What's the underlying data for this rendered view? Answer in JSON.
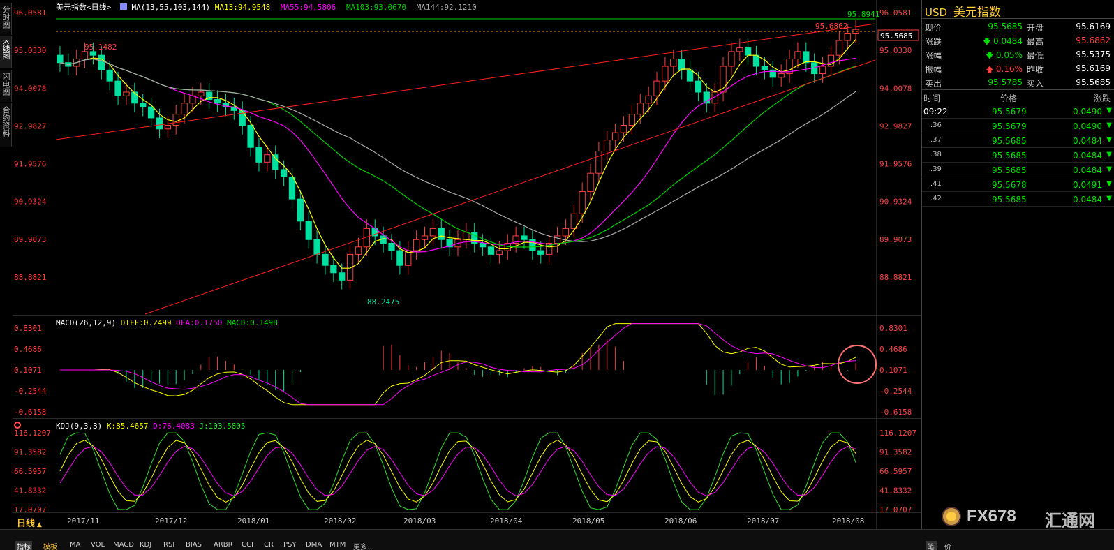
{
  "left_tabs": [
    {
      "label": "分时图"
    },
    {
      "label": "K线图"
    },
    {
      "label": "闪电图"
    },
    {
      "label": "合约资料"
    }
  ],
  "main_legend": {
    "name": "美元指数",
    "period": "<日线>",
    "ma_prefix": "MA(13,55,103,144)",
    "ma13": "MA13:94.9548",
    "ma55": "MA55:94.5806",
    "ma103": "MA103:93.0670",
    "ma144": "MA144:92.1210"
  },
  "price_axis": [
    "96.0581",
    "95.0330",
    "94.0078",
    "92.9827",
    "91.9576",
    "90.9324",
    "89.9073",
    "88.8821"
  ],
  "annotations": {
    "high_left": "95.1482",
    "low": "88.2475",
    "high_right": "95.6862",
    "top_line": "95.8941",
    "current_box": "95.5685"
  },
  "macd_legend": {
    "name": "MACD(26,12,9)",
    "diff": "DIFF:0.2499",
    "dea": "DEA:0.1750",
    "macd": "MACD:0.1498"
  },
  "macd_axis": [
    "0.8301",
    "0.4686",
    "0.1071",
    "-0.2544",
    "-0.6158"
  ],
  "kdj_legend": {
    "name": "KDJ(9,3,3)",
    "k": "K:85.4657",
    "d": "D:76.4083",
    "j": "J:103.5805"
  },
  "kdj_axis": [
    "116.1207",
    "91.3582",
    "66.5957",
    "41.8332",
    "17.0707"
  ],
  "x_axis": [
    "2017/11",
    "2017/12",
    "2018/01",
    "2018/02",
    "2018/03",
    "2018/04",
    "2018/05",
    "2018/06",
    "2018/07",
    "2018/08"
  ],
  "quote": {
    "code": "USD",
    "name": "美元指数",
    "rows": [
      {
        "l1": "现价",
        "v1": "95.5685",
        "l2": "开盘",
        "v2": "95.6169"
      },
      {
        "l1": "涨跌",
        "v1": "0.0484",
        "l2": "最高",
        "v2": "95.6862"
      },
      {
        "l1": "涨幅",
        "v1": "0.05%",
        "l2": "最低",
        "v2": "95.5375"
      },
      {
        "l1": "振幅",
        "v1": "0.16%",
        "l2": "昨收",
        "v2": "95.6169"
      },
      {
        "l1": "卖出",
        "v1": "95.5785",
        "l2": "买入",
        "v2": "95.5685"
      }
    ],
    "tick_header": {
      "time": "时间",
      "price": "价格",
      "change": "涨跌"
    },
    "ticks": [
      {
        "time": "09:22",
        "price": "95.5679",
        "change": "0.0490"
      },
      {
        "time": ".36",
        "price": "95.5679",
        "change": "0.0490"
      },
      {
        "time": ".37",
        "price": "95.5685",
        "change": "0.0484"
      },
      {
        "time": ".38",
        "price": "95.5685",
        "change": "0.0484"
      },
      {
        "time": ".39",
        "price": "95.5685",
        "change": "0.0484"
      },
      {
        "time": ".41",
        "price": "95.5678",
        "change": "0.0491"
      },
      {
        "time": ".42",
        "price": "95.5685",
        "change": "0.0484"
      }
    ]
  },
  "bottom": {
    "period_label": "日线",
    "tabs": [
      "指标",
      "模板",
      "MA",
      "VOL",
      "MACD",
      "KDJ",
      "RSI",
      "BIAS",
      "ARBR",
      "CCI",
      "CR",
      "PSY",
      "DMA",
      "MTM",
      "更多..."
    ],
    "right_tabs": [
      "笔",
      "价"
    ]
  },
  "logo": {
    "text": "FX678",
    "cn": "汇通网"
  },
  "colors": {
    "up": "#ff4040",
    "down": "#00e0a0",
    "ma13": "#ffff00",
    "ma55": "#ff00ff",
    "ma103": "#00d000",
    "ma144": "#aaaaaa",
    "trend": "#ff2020",
    "kdj_j": "#30e030"
  },
  "chart_data": {
    "type": "candlestick",
    "x_categories": [
      "2017/11",
      "2017/12",
      "2018/01",
      "2018/02",
      "2018/03",
      "2018/04",
      "2018/05",
      "2018/06",
      "2018/07",
      "2018/08"
    ],
    "y_range": [
      88.2475,
      96.0581
    ],
    "close_series": [
      94.7,
      94.6,
      94.8,
      95.0,
      94.9,
      94.5,
      94.2,
      93.8,
      93.9,
      93.6,
      93.5,
      93.2,
      92.9,
      93.0,
      93.3,
      93.6,
      93.8,
      93.9,
      93.7,
      93.6,
      93.5,
      93.4,
      93.0,
      92.4,
      92.0,
      92.2,
      91.8,
      91.6,
      91.0,
      90.4,
      89.9,
      89.5,
      89.2,
      89.0,
      88.8,
      89.5,
      89.7,
      90.2,
      90.0,
      89.8,
      89.6,
      89.2,
      89.6,
      89.9,
      90.0,
      90.2,
      89.9,
      89.7,
      89.9,
      90.1,
      89.8,
      89.7,
      89.5,
      89.6,
      89.8,
      90.0,
      89.9,
      89.6,
      89.5,
      89.8,
      90.0,
      90.2,
      90.6,
      91.2,
      91.7,
      92.3,
      92.6,
      92.8,
      93.0,
      93.3,
      93.6,
      93.8,
      94.2,
      94.6,
      94.8,
      94.5,
      94.2,
      93.9,
      93.6,
      93.9,
      94.6,
      95.0,
      95.1,
      94.9,
      94.6,
      94.5,
      94.3,
      94.4,
      94.8,
      95.0,
      94.7,
      94.4,
      94.6,
      94.9,
      95.3,
      95.5,
      95.6
    ],
    "ma13_end": 94.9548,
    "ma55_end": 94.5806,
    "ma103_end": 93.067,
    "ma144_end": 92.121,
    "macd": {
      "diff": 0.2499,
      "dea": 0.175,
      "macd": 0.1498,
      "y_range": [
        -0.6158,
        0.8301
      ]
    },
    "kdj": {
      "k": 85.4657,
      "d": 76.4083,
      "j": 103.5805,
      "y_range": [
        17.0707,
        116.1207
      ]
    }
  }
}
